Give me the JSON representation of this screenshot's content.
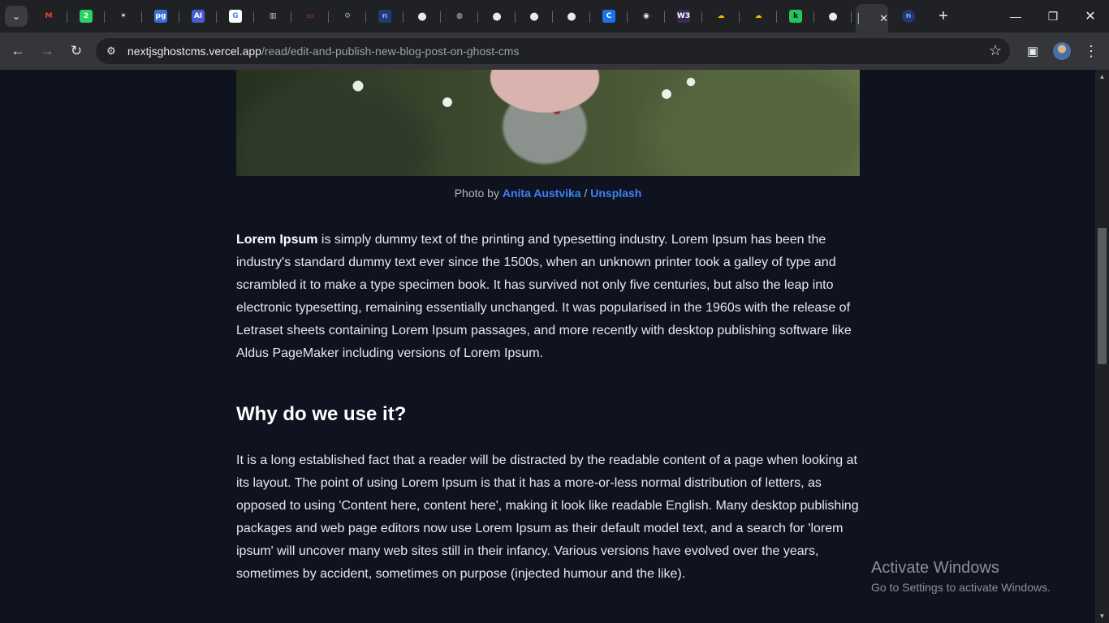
{
  "browser": {
    "tabs": [
      {
        "icon": "gmail-icon",
        "glyph": "M",
        "bg": "#202124",
        "fg": "#ea4335"
      },
      {
        "icon": "whatsapp-icon",
        "glyph": "2",
        "bg": "#25d366",
        "fg": "#ffffff"
      },
      {
        "icon": "pinwheel-icon",
        "glyph": "✶",
        "bg": "#202124",
        "fg": "#e8eaed"
      },
      {
        "icon": "pg-icon",
        "glyph": "pg",
        "bg": "#3b6fd8",
        "fg": "#ffffff"
      },
      {
        "icon": "ai-icon",
        "glyph": "AI",
        "bg": "#4a5bd8",
        "fg": "#ffffff"
      },
      {
        "icon": "google-icon",
        "glyph": "G",
        "bg": "#ffffff",
        "fg": "#4285f4"
      },
      {
        "icon": "docs-icon",
        "glyph": "▥",
        "bg": "#202124",
        "fg": "#c7c9cc"
      },
      {
        "icon": "pill-icon",
        "glyph": "▭",
        "bg": "#202124",
        "fg": "#ea4335"
      },
      {
        "icon": "settings-icon",
        "glyph": "⚙",
        "bg": "#202124",
        "fg": "#9aa0a6"
      },
      {
        "icon": "n-icon",
        "glyph": "n",
        "bg": "#1f3b73",
        "fg": "#7fb0ff"
      },
      {
        "icon": "github-icon",
        "glyph": "●",
        "bg": "#202124",
        "fg": "#e8eaed"
      },
      {
        "icon": "globe-icon",
        "glyph": "◍",
        "bg": "#202124",
        "fg": "#c7c9cc"
      },
      {
        "icon": "github-icon",
        "glyph": "●",
        "bg": "#202124",
        "fg": "#e8eaed"
      },
      {
        "icon": "github-icon",
        "glyph": "●",
        "bg": "#202124",
        "fg": "#e8eaed"
      },
      {
        "icon": "github-icon",
        "glyph": "●",
        "bg": "#202124",
        "fg": "#e8eaed"
      },
      {
        "icon": "c-icon",
        "glyph": "C",
        "bg": "#1a73e8",
        "fg": "#ffffff"
      },
      {
        "icon": "bot-icon",
        "glyph": "◉",
        "bg": "#202124",
        "fg": "#e8eaed"
      },
      {
        "icon": "w3-icon",
        "glyph": "W3",
        "bg": "#3a2a5a",
        "fg": "#ffffff"
      },
      {
        "icon": "cloud-icon",
        "glyph": "☁",
        "bg": "#202124",
        "fg": "#fbbc04"
      },
      {
        "icon": "cloud-icon",
        "glyph": "☁",
        "bg": "#202124",
        "fg": "#fbbc04"
      },
      {
        "icon": "k-icon",
        "glyph": "k",
        "bg": "#22c55e",
        "fg": "#0b0b0b"
      },
      {
        "icon": "github-icon",
        "glyph": "●",
        "bg": "#202124",
        "fg": "#e8eaed"
      }
    ],
    "active_tab": {
      "icon": "blank-favicon-icon",
      "glyph": "▏",
      "close": "✕"
    },
    "last_tab": {
      "icon": "n-icon",
      "glyph": "n"
    },
    "new_tab": "+",
    "url_host": "nextjsghostcms.vercel.app",
    "url_path": "/read/edit-and-publish-new-blog-post-on-ghost-cms"
  },
  "article": {
    "caption_prefix": "Photo by ",
    "caption_author": "Anita Austvika",
    "caption_sep": " / ",
    "caption_source": "Unsplash",
    "p1_bold": "Lorem Ipsum",
    "p1_rest": " is simply dummy text of the printing and typesetting industry. Lorem Ipsum has been the industry's standard dummy text ever since the 1500s, when an unknown printer took a galley of type and scrambled it to make a type specimen book. It has survived not only five centuries, but also the leap into electronic typesetting, remaining essentially unchanged. It was popularised in the 1960s with the release of Letraset sheets containing Lorem Ipsum passages, and more recently with desktop publishing software like Aldus PageMaker including versions of Lorem Ipsum.",
    "heading": "Why do we use it?",
    "p2": "It is a long established fact that a reader will be distracted by the readable content of a page when looking at its layout. The point of using Lorem Ipsum is that it has a more-or-less normal distribution of letters, as opposed to using 'Content here, content here', making it look like readable English. Many desktop publishing packages and web page editors now use Lorem Ipsum as their default model text, and a search for 'lorem ipsum' will uncover many web sites still in their infancy. Various versions have evolved over the years, sometimes by accident, sometimes on purpose (injected humour and the like)."
  },
  "watermark": {
    "line1": "Activate Windows",
    "line2": "Go to Settings to activate Windows."
  },
  "scroll_fraction": 0.37
}
